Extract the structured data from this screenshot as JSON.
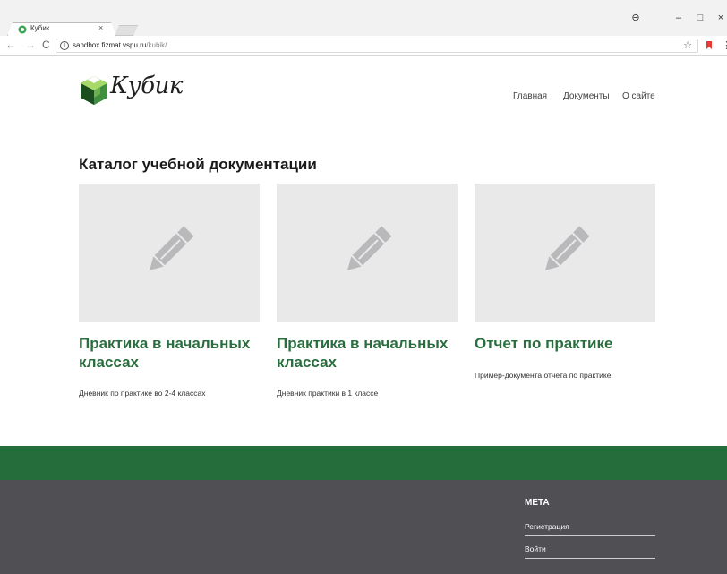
{
  "browser": {
    "tab_title": "Кубик",
    "tab_close": "×",
    "url_host": "sandbox.fizmat.vspu.ru",
    "url_path": "/kubik/",
    "controls": {
      "profile": "⊖",
      "minimize": "–",
      "maximize": "□",
      "close": "×"
    }
  },
  "site": {
    "logo_text": "Кубик",
    "nav": {
      "home": "Главная",
      "documents": "Документы",
      "about": "О сайте"
    },
    "catalog_title": "Каталог учебной документации",
    "cards": [
      {
        "title": "Практика в начальных классах",
        "description": "Дневник по практике во 2-4 классах"
      },
      {
        "title": "Практика в начальных классах",
        "description": "Дневник практики в 1 классе"
      },
      {
        "title": "Отчет по практике",
        "description": "Пример-документа отчета по практике"
      }
    ],
    "footer": {
      "meta_title": "META",
      "register": "Регистрация",
      "login": "Войти"
    }
  },
  "colors": {
    "brand_green": "#2a6e3f",
    "green_band": "#256d3a",
    "footer_bg": "#4f4f54",
    "thumb_bg": "#e9e9ea"
  }
}
